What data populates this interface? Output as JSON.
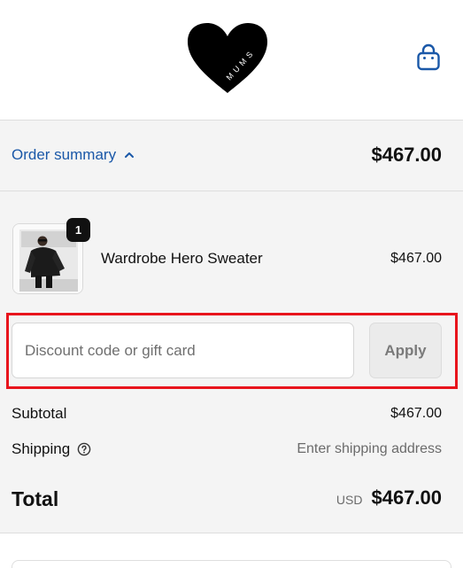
{
  "brand": {
    "logo_text": "MUMS"
  },
  "order_summary": {
    "toggle_label": "Order summary",
    "total": "$467.00"
  },
  "line_item": {
    "quantity": "1",
    "name": "Wardrobe Hero Sweater",
    "price": "$467.00"
  },
  "discount": {
    "placeholder": "Discount code or gift card",
    "value": "",
    "apply_label": "Apply"
  },
  "totals": {
    "subtotal_label": "Subtotal",
    "subtotal_value": "$467.00",
    "shipping_label": "Shipping",
    "shipping_value": "Enter shipping address",
    "total_label": "Total",
    "currency": "USD",
    "total_value": "$467.00"
  },
  "colors": {
    "link": "#1a58a8",
    "highlight": "#e8141c",
    "panel_bg": "#f4f4f4"
  },
  "icons": {
    "cart": "shopping-bag-icon",
    "toggle": "chevron-up-icon",
    "help": "question-circle-icon"
  }
}
